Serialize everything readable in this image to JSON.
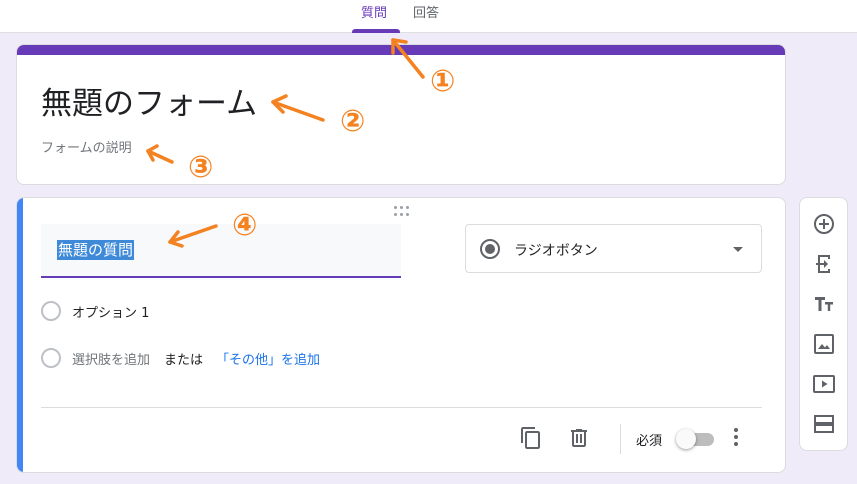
{
  "tabs": [
    {
      "label": "質問",
      "active": true
    },
    {
      "label": "回答",
      "active": false
    }
  ],
  "form": {
    "title": "無題のフォーム",
    "description_placeholder": "フォームの説明"
  },
  "question": {
    "title": "無題の質問",
    "type_label": "ラジオボタン",
    "options": [
      {
        "label": "オプション 1"
      }
    ],
    "add_option": {
      "add_label": "選択肢を追加",
      "or_label": "または",
      "other_label": "「その他」を追加"
    },
    "required_label": "必須",
    "required": false
  },
  "side_toolbar": {
    "icons": [
      "add-question-icon",
      "import-questions-icon",
      "add-title-icon",
      "add-image-icon",
      "add-video-icon",
      "add-section-icon"
    ]
  },
  "annotations": [
    "①",
    "②",
    "③",
    "④"
  ],
  "colors": {
    "theme": "#673ab7",
    "background": "#f0ebf8",
    "question_accent": "#4285f4",
    "annotation": "#f58220",
    "link": "#1a73e8"
  }
}
